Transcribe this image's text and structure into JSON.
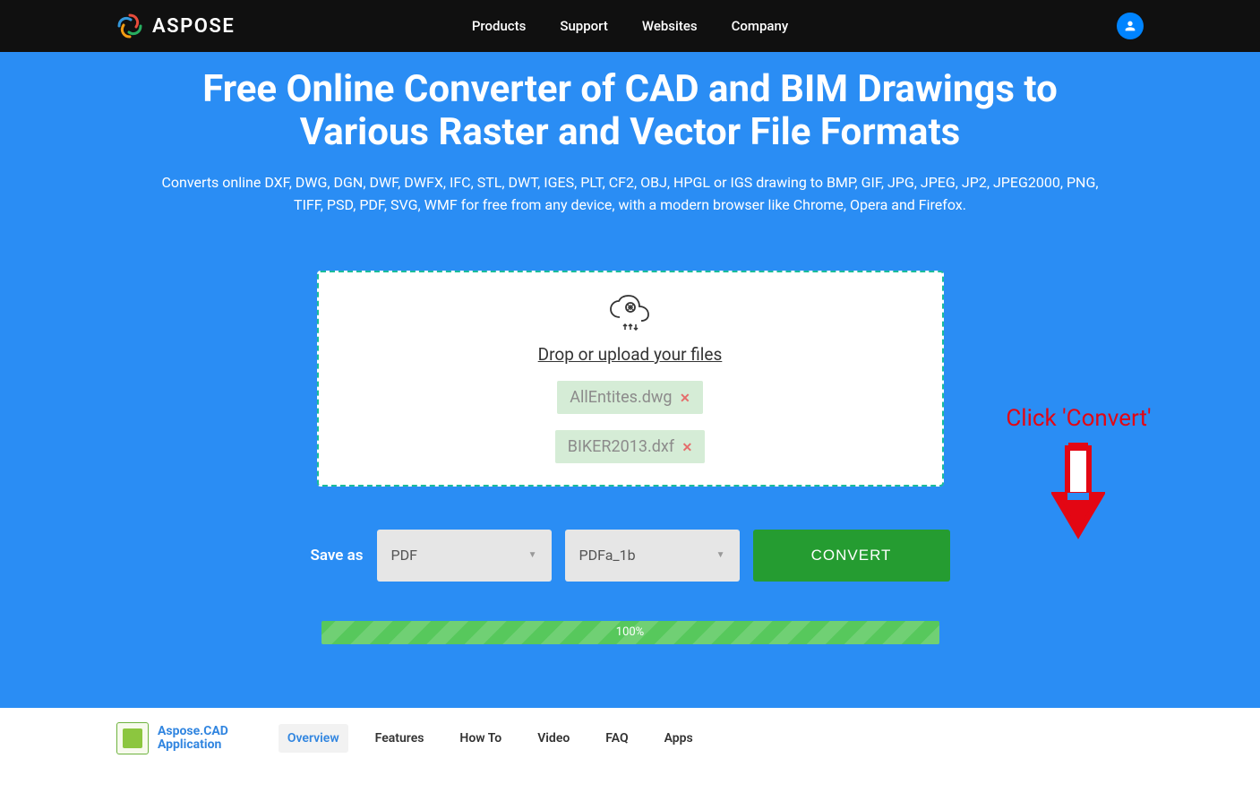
{
  "header": {
    "brand": "ASPOSE",
    "nav": [
      "Products",
      "Support",
      "Websites",
      "Company"
    ]
  },
  "hero": {
    "title": "Free Online Converter of CAD and BIM Drawings to Various Raster and Vector File Formats",
    "subtitle": "Converts online DXF, DWG, DGN, DWF, DWFX, IFC, STL, DWT, IGES, PLT, CF2, OBJ, HPGL or IGS drawing to BMP, GIF, JPG, JPEG, JP2, JPEG2000, PNG, TIFF, PSD, PDF, SVG, WMF for free from any device, with a modern browser like Chrome, Opera and Firefox."
  },
  "upload": {
    "drop_text": "Drop or upload your files",
    "files": [
      "AllEntites.dwg",
      "BIKER2013.dxf"
    ]
  },
  "annotation": {
    "text": "Click 'Convert'"
  },
  "save": {
    "label": "Save as",
    "format": "PDF",
    "subformat": "PDFa_1b",
    "convert_label": "CONVERT"
  },
  "progress": {
    "percent": "100%"
  },
  "footer": {
    "app_line1": "Aspose.CAD",
    "app_line2": "Application",
    "tabs": [
      "Overview",
      "Features",
      "How To",
      "Video",
      "FAQ",
      "Apps"
    ],
    "active_tab": 0
  }
}
